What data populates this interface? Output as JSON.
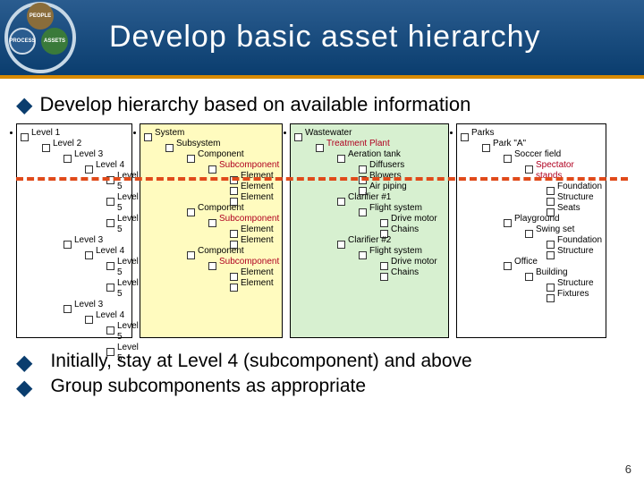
{
  "header": {
    "title": "Develop basic asset hierarchy",
    "logo": {
      "gear1": "PEOPLE",
      "gear2": "PROCESS",
      "gear3": "ASSETS"
    }
  },
  "bullets": {
    "main": "Develop hierarchy based on available information",
    "sub1": "Initially, stay at Level 4 (subcomponent) and above",
    "sub2": "Group subcomponents as appropriate"
  },
  "trees": {
    "generic": {
      "l1": "Level 1",
      "l2": "Level 2",
      "l3a": "Level 3",
      "l4a": "Level 4",
      "l5a1": "Level 5",
      "l5a2": "Level 5",
      "l5a3": "Level 5",
      "l3b": "Level 3",
      "l4b": "Level 4",
      "l5b1": "Level 5",
      "l5b2": "Level 5",
      "l3c": "Level 3",
      "l4c": "Level 4",
      "l5c1": "Level 5",
      "l5c2": "Level 5"
    },
    "system": {
      "l1": "System",
      "l2": "Subsystem",
      "l3a": "Component",
      "l4a": "Subcomponent",
      "l5a1": "Element",
      "l5a2": "Element",
      "l5a3": "Element",
      "l3b": "Component",
      "l4b": "Subcomponent",
      "l5b1": "Element",
      "l5b2": "Element",
      "l3c": "Component",
      "l4c": "Subcomponent",
      "l5c1": "Element",
      "l5c2": "Element"
    },
    "wastewater": {
      "l1": "Wastewater",
      "l2": "Treatment Plant",
      "l3a": "Aeration tank",
      "l5a1": "Diffusers",
      "l5a2": "Blowers",
      "l5a3": "Air piping",
      "l3b": "Clarifier #1",
      "l4b": "Flight system",
      "l5b1": "Drive motor",
      "l5b2": "Chains",
      "l3c": "Clarifier #2",
      "l4c": "Flight system",
      "l5c1": "Drive motor",
      "l5c2": "Chains"
    },
    "parks": {
      "l1": "Parks",
      "l2": "Park \"A\"",
      "l3a": "Soccer field",
      "l4a": "Spectator stands",
      "l5a1": "Foundation",
      "l5a2": "Structure",
      "l5a3": "Seats",
      "l3b": "Playground",
      "l4b": "Swing set",
      "l5b1": "Foundation",
      "l5b2": "Structure",
      "l3c": "Office",
      "l4c": "Building",
      "l5c1": "Structure",
      "l5c2": "Fixtures"
    }
  },
  "page_number": "6"
}
